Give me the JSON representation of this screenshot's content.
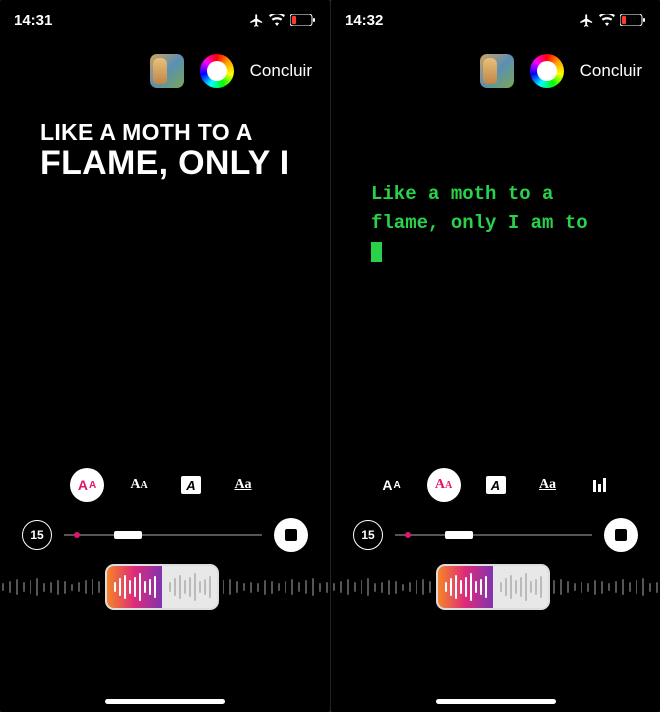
{
  "left": {
    "time": "14:31",
    "done": "Concluir",
    "duration": "15",
    "lyric_line1": "Like a moth to a",
    "lyric_line2": "flame, only I",
    "styles": [
      "Aa-bold",
      "Aa-serif",
      "A-box",
      "Aa-underline"
    ],
    "active_style_index": 0
  },
  "right": {
    "time": "14:32",
    "done": "Concluir",
    "duration": "15",
    "lyric_line1": "Like a moth to a",
    "lyric_line2": "flame, only I am to",
    "styles": [
      "Aa-bold",
      "Aa-serif",
      "A-box",
      "Aa-underline",
      "bars"
    ],
    "active_style_index": 1
  },
  "colors": {
    "accent": "#e2146c",
    "mono_green": "#29d24a"
  }
}
